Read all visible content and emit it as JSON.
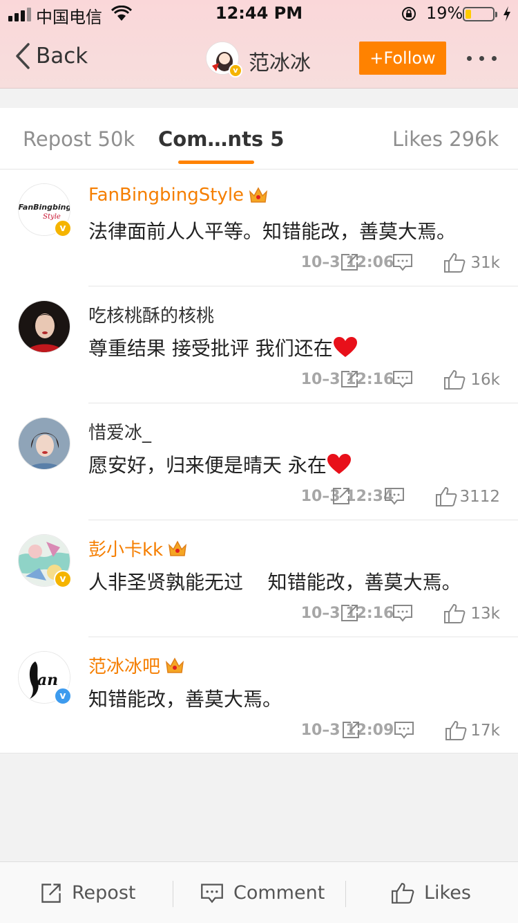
{
  "status_bar": {
    "carrier": "中国电信",
    "time": "12:44 PM",
    "battery_percent": "19%",
    "battery_level": 0.19
  },
  "header": {
    "back_label": "Back",
    "user_name": "范冰冰",
    "follow_label": "+Follow"
  },
  "tabs": [
    {
      "label": "Repost 50k"
    },
    {
      "label": "Com…nts 5"
    },
    {
      "label": "Likes 296k"
    }
  ],
  "comments": [
    {
      "name": "FanBingbingStyle",
      "text": "法律面前人人平等。知错能改，善莫大焉。",
      "time": "10–3 12:06",
      "likes": "31k",
      "avatar_text": "FanBingbing",
      "avatar_text2": "Style"
    },
    {
      "name": "吃核桃酥的核桃",
      "text": "尊重结果 接受批评  我们还在",
      "time": "10–3 12:16",
      "likes": "16k"
    },
    {
      "name": "惜爱冰_",
      "text": "愿安好，归来便是晴天 永在",
      "time": "10–3 12:34",
      "likes": "3112"
    },
    {
      "name": "彭小卡kk",
      "text": "人非圣贤孰能无过    知错能改，善莫大焉。",
      "time": "10–3 12:16",
      "likes": "13k"
    },
    {
      "name": "范冰冰吧",
      "text": "知错能改，善莫大焉。",
      "time": "10–3 12:09",
      "likes": "17k"
    }
  ],
  "bottom_bar": {
    "repost_label": "Repost",
    "comment_label": "Comment",
    "likes_label": "Likes"
  },
  "colors": {
    "accent": "#ff8200",
    "vip_name": "#f57e00",
    "header_bg": "#fad7d9"
  }
}
